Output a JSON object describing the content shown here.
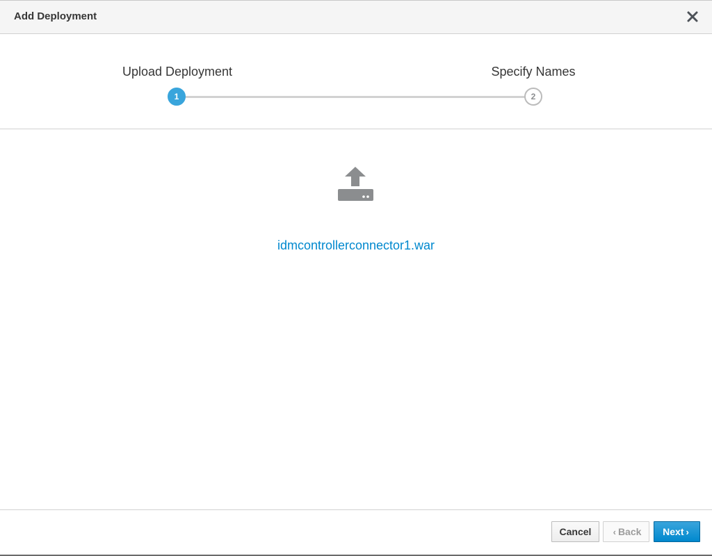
{
  "dialog": {
    "title": "Add Deployment",
    "close_icon": "close-icon"
  },
  "wizard": {
    "steps": [
      {
        "label": "Upload Deployment",
        "number": "1",
        "state": "active"
      },
      {
        "label": "Specify Names",
        "number": "2",
        "state": "inactive"
      }
    ]
  },
  "upload": {
    "icon": "upload-icon",
    "file_name": "idmcontrollerconnector1.war"
  },
  "footer": {
    "cancel_label": "Cancel",
    "back_label": "Back",
    "back_icon": "chevron-left-icon",
    "next_label": "Next",
    "next_icon": "chevron-right-icon"
  },
  "colors": {
    "accent": "#39a5dc",
    "link": "#0088ce",
    "primary_button": "#0088ce",
    "header_bg": "#f5f5f5"
  }
}
